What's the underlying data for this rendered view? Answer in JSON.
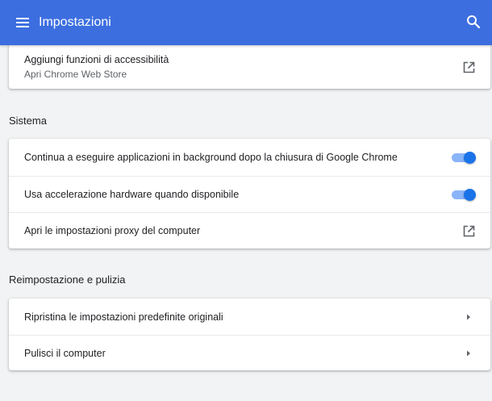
{
  "header": {
    "title": "Impostazioni",
    "menu_icon": "hamburger-menu-icon",
    "search_icon": "search-icon"
  },
  "accessibility": {
    "label": "Aggiungi funzioni di accessibilità",
    "sub": "Apri Chrome Web Store",
    "icon": "open-in-new-icon"
  },
  "system": {
    "title": "Sistema",
    "items": [
      {
        "label": "Continua a eseguire applicazioni in background dopo la chiusura di Google Chrome",
        "control": "toggle",
        "checked": true
      },
      {
        "label": "Usa accelerazione hardware quando disponibile",
        "control": "toggle",
        "checked": true
      },
      {
        "label": "Apri le impostazioni proxy del computer",
        "control": "open-in-new-icon"
      }
    ]
  },
  "reset": {
    "title": "Reimpostazione e pulizia",
    "items": [
      {
        "label": "Ripristina le impostazioni predefinite originali",
        "control": "chevron-right-icon"
      },
      {
        "label": "Pulisci il computer",
        "control": "chevron-right-icon"
      }
    ]
  },
  "colors": {
    "header_bg": "#3c6ee0",
    "toggle_on": "#1a73e8",
    "toggle_track": "#8ab4f8",
    "page_bg": "#f1f3f4"
  }
}
